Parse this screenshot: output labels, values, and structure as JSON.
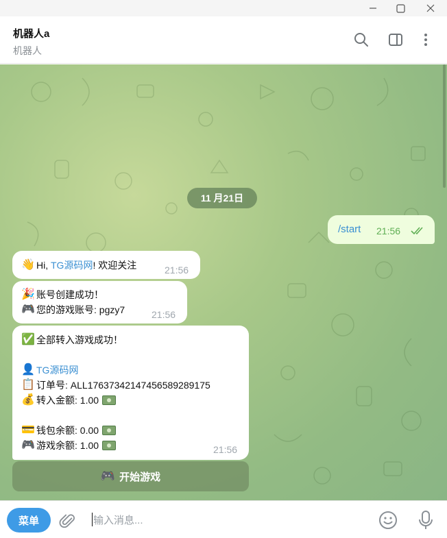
{
  "window": {
    "icons": {
      "minimize": "minimize-icon",
      "maximize": "maximize-icon",
      "close": "close-icon"
    }
  },
  "header": {
    "title": "机器人a",
    "subtitle": "机器人",
    "icons": {
      "search": "search-icon",
      "panel": "sidebar-panel-icon",
      "more": "more-vertical-icon"
    }
  },
  "chat": {
    "date": "11 月21日",
    "outgoing": {
      "text": "/start",
      "time": "21:56",
      "status": "read-double-check-icon",
      "status_color": "#5fae54"
    },
    "incoming": [
      {
        "time": "21:56",
        "lines": [
          {
            "emoji": "👋",
            "prefix": "Hi, ",
            "link": "TG源码网",
            "suffix": "! 欢迎关注"
          }
        ]
      },
      {
        "time": "21:56",
        "lines": [
          {
            "emoji": "🎉",
            "text": "账号创建成功！"
          },
          {
            "emoji": "🎮",
            "text": "您的游戏账号: pgzy7"
          }
        ]
      },
      {
        "time": "21:56",
        "lines": [
          {
            "emoji": "✅",
            "text": "全部转入游戏成功！"
          },
          {
            "emoji": "👤",
            "link": "TG源码网"
          },
          {
            "emoji": "📋",
            "text": "订单号: ALL17637342147456589289175"
          },
          {
            "emoji": "💰",
            "text": "转入金额: 1.00"
          },
          {
            "emoji": "💳",
            "text": "钱包余额: 0.00"
          },
          {
            "emoji": "🎮",
            "text": "游戏余额: 1.00"
          }
        ],
        "money_icon": "money-bill-icon"
      }
    ],
    "inline_button": {
      "emoji": "🎮",
      "label": "开始游戏"
    }
  },
  "composer": {
    "menu_label": "菜单",
    "placeholder": "输入消息...",
    "icons": {
      "attach": "paperclip-icon",
      "emoji": "emoji-smile-icon",
      "mic": "microphone-icon"
    }
  },
  "colors": {
    "accent": "#3e9be6",
    "link": "#3a8fd2",
    "outgoing_bubble": "#effdde",
    "incoming_bubble": "#ffffff",
    "chat_background": "#a8c889"
  }
}
